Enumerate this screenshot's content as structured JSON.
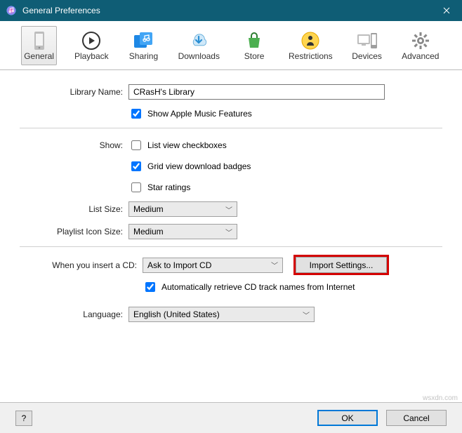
{
  "window": {
    "title": "General Preferences"
  },
  "toolbar": {
    "items": [
      {
        "label": "General"
      },
      {
        "label": "Playback"
      },
      {
        "label": "Sharing"
      },
      {
        "label": "Downloads"
      },
      {
        "label": "Store"
      },
      {
        "label": "Restrictions"
      },
      {
        "label": "Devices"
      },
      {
        "label": "Advanced"
      }
    ]
  },
  "fields": {
    "library_name_label": "Library Name:",
    "library_name_value": "CRasH's Library",
    "show_apple_music": "Show Apple Music Features",
    "show_label": "Show:",
    "list_view_checkboxes": "List view checkboxes",
    "grid_view_badges": "Grid view download badges",
    "star_ratings": "Star ratings",
    "list_size_label": "List Size:",
    "list_size_value": "Medium",
    "playlist_icon_label": "Playlist Icon Size:",
    "playlist_icon_value": "Medium",
    "insert_cd_label": "When you insert a CD:",
    "insert_cd_value": "Ask to Import CD",
    "import_settings_btn": "Import Settings...",
    "auto_retrieve": "Automatically retrieve CD track names from Internet",
    "language_label": "Language:",
    "language_value": "English (United States)"
  },
  "buttons": {
    "help": "?",
    "ok": "OK",
    "cancel": "Cancel"
  },
  "watermark": "wsxdn.com"
}
